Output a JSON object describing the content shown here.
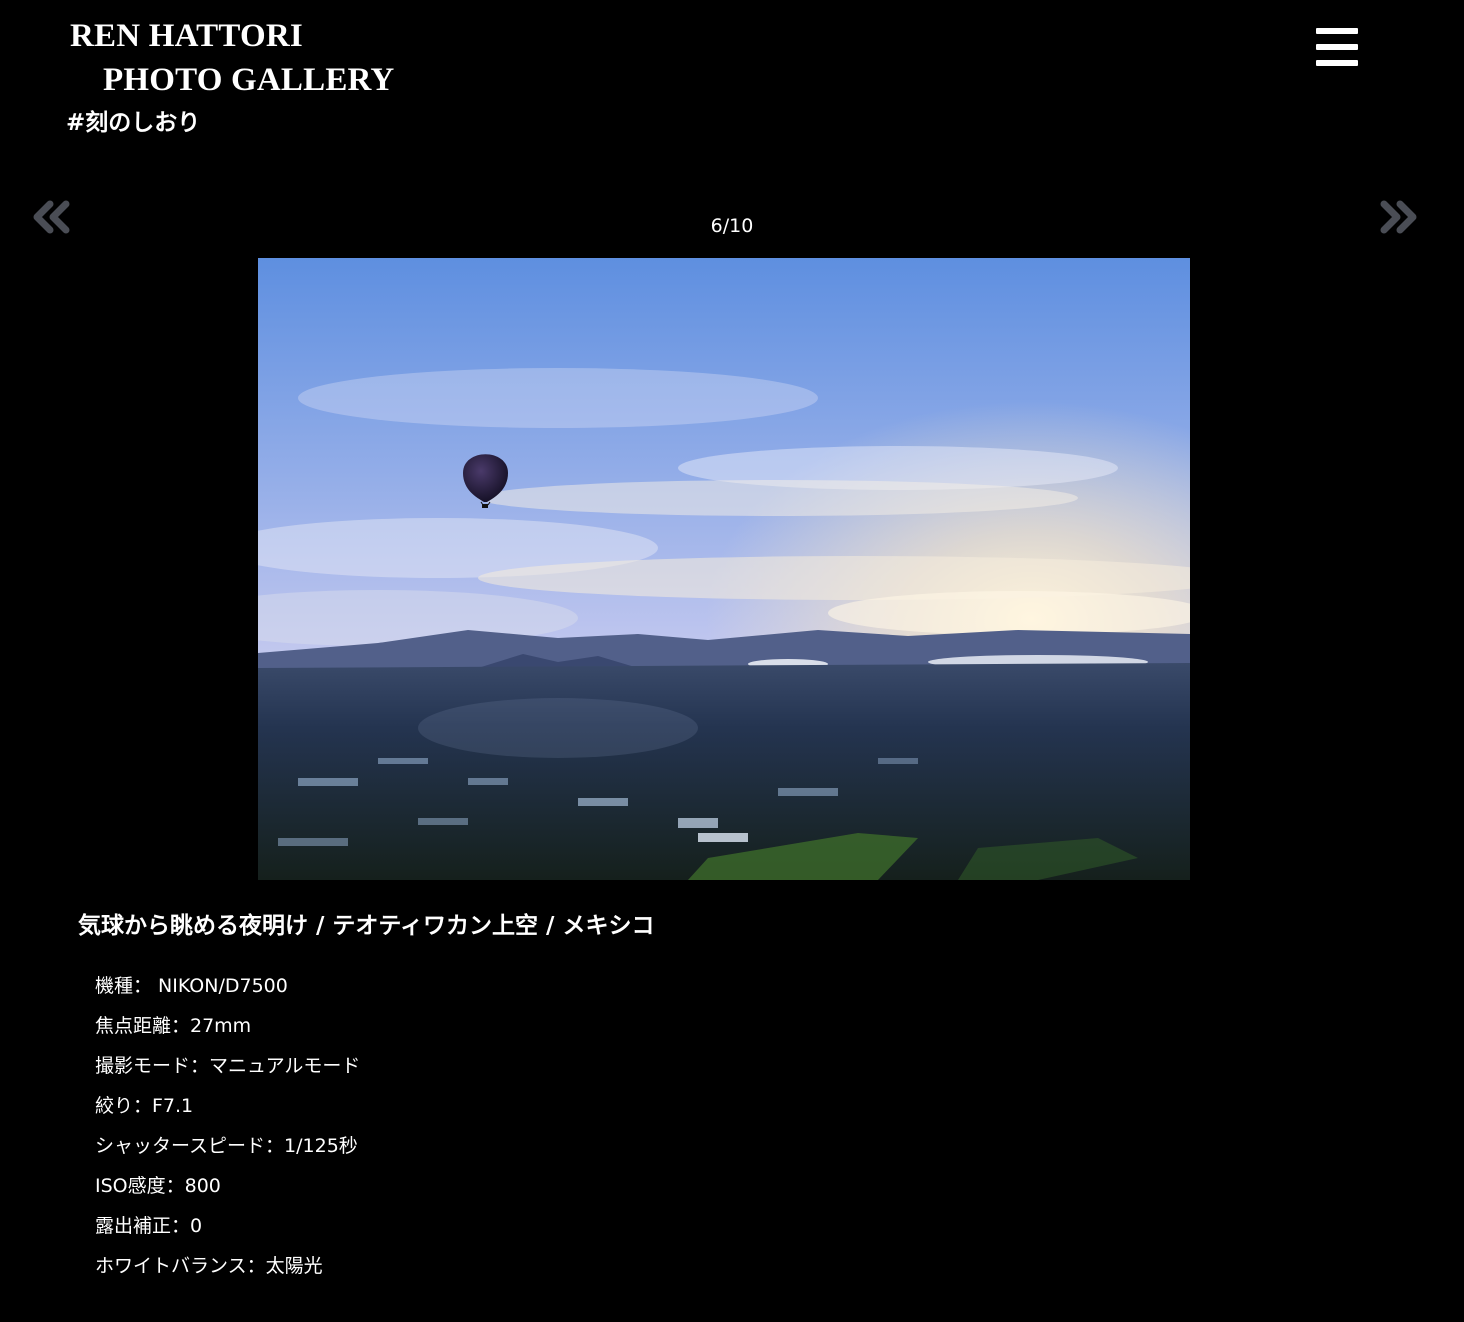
{
  "header": {
    "title_line1": "REN HATTORI",
    "title_line2": "PHOTO GALLERY",
    "tagline": "#刻のしおり",
    "menu_icon": "hamburger-menu-icon"
  },
  "navigation": {
    "prev_icon": "double-chevron-left-icon",
    "next_icon": "double-chevron-right-icon",
    "counter": "6/10"
  },
  "photo": {
    "description": "hot air balloon over plain at dawn",
    "colors": {
      "sky_top": "#5e8fe0",
      "sky_mid": "#a8b8ee",
      "horizon_glow": "#f3e4c8",
      "ground": "#1d2a3a"
    }
  },
  "caption": {
    "title": "気球から眺める夜明け / テオティワカン上空 / メキシコ",
    "specs": [
      "機種： NIKON/D7500",
      "焦点距離：27mm",
      "撮影モード：マニュアルモード",
      "絞り：F7.1",
      "シャッタースピード：1/125秒",
      "ISO感度：800",
      "露出補正：0",
      "ホワイトバランス：太陽光"
    ]
  },
  "colors": {
    "background": "#000000",
    "text": "#ffffff",
    "arrow": "#4a4d55"
  }
}
